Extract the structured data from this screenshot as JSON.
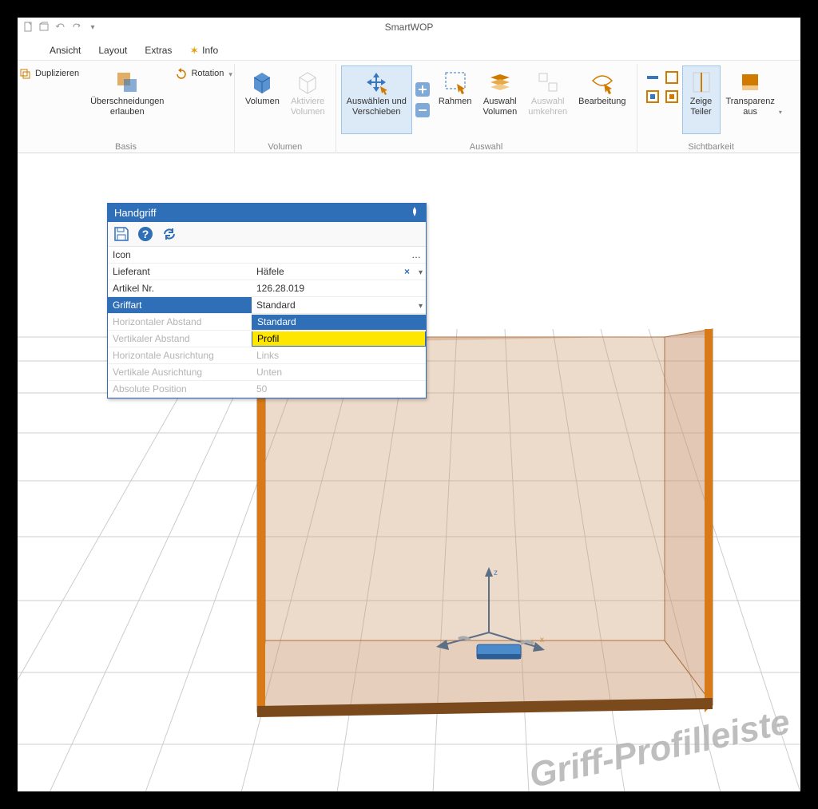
{
  "app": {
    "title": "SmartWOP"
  },
  "menubar": {
    "items": [
      "Ansicht",
      "Layout",
      "Extras",
      "Info"
    ]
  },
  "ribbon": {
    "duplicate": "Duplizieren",
    "overlap": "Überschneidungen\nerlauben",
    "rotation": "Rotation",
    "basis_label": "Basis",
    "volumen": "Volumen",
    "aktiviere_volumen": "Aktiviere\nVolumen",
    "volumen_label": "Volumen",
    "auswahlen": "Auswählen und\nVerschieben",
    "rahmen": "Rahmen",
    "auswahl_volumen": "Auswahl\nVolumen",
    "auswahl_umkehren": "Auswahl\numkehren",
    "bearbeitung": "Bearbeitung",
    "auswahl_label": "Auswahl",
    "zeige_teiler": "Zeige\nTeiler",
    "transparenz": "Transparenz\naus",
    "sichtbarkeit_label": "Sichtbarkeit"
  },
  "panel": {
    "title": "Handgriff",
    "rows": [
      {
        "label": "Icon",
        "value": "",
        "has_ellipsis": true
      },
      {
        "label": "Lieferant",
        "value": "Häfele",
        "has_clear": true,
        "has_dd": true
      },
      {
        "label": "Artikel Nr.",
        "value": "126.28.019"
      },
      {
        "label": "Griffart",
        "value": "Standard",
        "selected": true,
        "has_dd": true
      },
      {
        "label": "Horizontaler Abstand",
        "value": "",
        "disabled": true
      },
      {
        "label": "Vertikaler Abstand",
        "value": "",
        "disabled": true
      },
      {
        "label": "Horizontale Ausrichtung",
        "value": "Links",
        "disabled": true
      },
      {
        "label": "Vertikale Ausrichtung",
        "value": "Unten",
        "disabled": true
      },
      {
        "label": "Absolute Position",
        "value": "50",
        "disabled": true
      }
    ],
    "dropdown": {
      "options": [
        "Standard",
        "Profil"
      ]
    }
  },
  "watermark": "Griff-Profilleiste"
}
